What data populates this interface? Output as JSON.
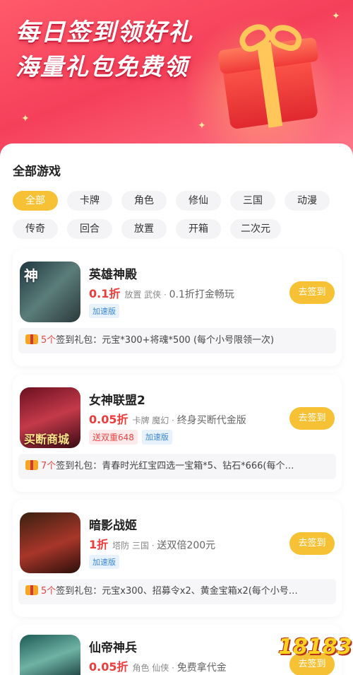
{
  "banner": {
    "title_line1": "每日签到领好礼",
    "title_line2": "海量礼包免费领"
  },
  "section": {
    "title": "全部游戏"
  },
  "tags": [
    "全部",
    "卡牌",
    "角色",
    "修仙",
    "三国",
    "动漫",
    "传奇",
    "回合",
    "放置",
    "开箱",
    "二次元"
  ],
  "active_tag": "全部",
  "games": [
    {
      "name": "英雄神殿",
      "discount": "0.1折",
      "genres": "放置 武侠",
      "desc": "0.1折打金畅玩",
      "badges": [
        "加速版"
      ],
      "button": "去签到",
      "gift_count": "5个",
      "gift_label": "签到礼包：",
      "gift_text": "元宝*300+将魂*500 (每个小号限领一次)",
      "icon_text": "神"
    },
    {
      "name": "女神联盟2",
      "discount": "0.05折",
      "genres": "卡牌 魔幻",
      "desc": "终身买断代金版",
      "badges": [
        "送双重648",
        "加速版"
      ],
      "button": "去签到",
      "gift_count": "7个",
      "gift_label": "签到礼包：",
      "gift_text": "青春时光红宝四选一宝箱*5、钻石*666(每个…",
      "icon_text": "买断商城"
    },
    {
      "name": "暗影战姬",
      "discount": "1折",
      "genres": "塔防 三国",
      "desc": "送双倍200元",
      "badges": [
        "加速版"
      ],
      "button": "去签到",
      "gift_count": "5个",
      "gift_label": "签到礼包：",
      "gift_text": "元宝x300、招募令x2、黄金宝箱x2(每个小号…",
      "icon_text": ""
    },
    {
      "name": "仙帝神兵",
      "discount": "0.05折",
      "genres": "角色 仙侠",
      "desc": "免费拿代金",
      "badges": [],
      "button": "去签到",
      "icon_text": ""
    }
  ],
  "watermark": "18183",
  "colors": {
    "accent": "#f7c136",
    "discount": "#ee3b3b",
    "speed_badge": "#3a86e0"
  }
}
